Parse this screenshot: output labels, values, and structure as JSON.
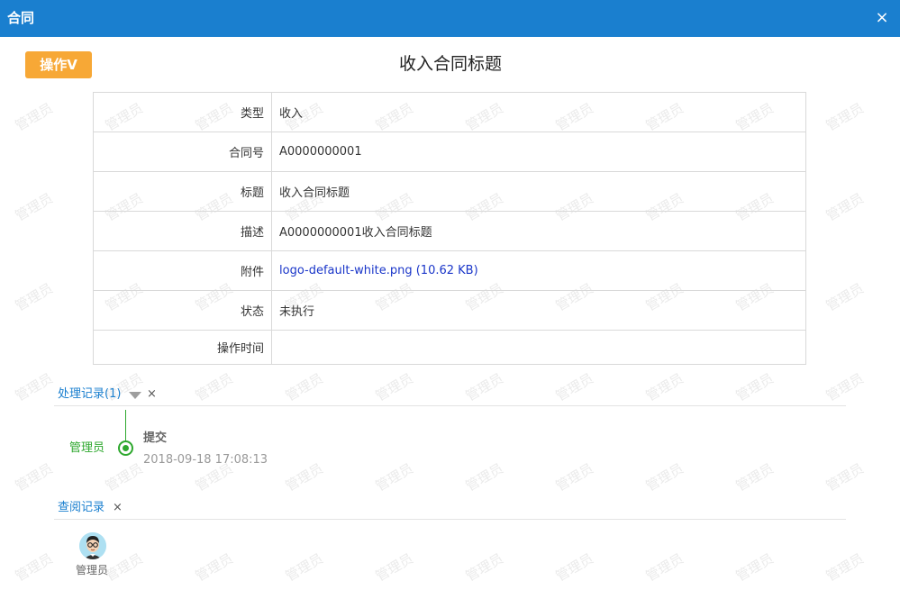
{
  "window": {
    "title": "合同",
    "close_label": "×"
  },
  "toolbar": {
    "operation_button": "操作V"
  },
  "document": {
    "title": "收入合同标题"
  },
  "fields": [
    {
      "label": "类型",
      "value": "收入"
    },
    {
      "label": "合同号",
      "value": "A0000000001"
    },
    {
      "label": "标题",
      "value": "收入合同标题"
    },
    {
      "label": "描述",
      "value": "A0000000001收入合同标题"
    },
    {
      "label": "附件",
      "value": "logo-default-white.png (10.62 KB)"
    },
    {
      "label": "状态",
      "value": "未执行"
    },
    {
      "label": "操作时间",
      "value": ""
    }
  ],
  "process_log": {
    "title": "处理记录(1)",
    "close_label": "×",
    "entries": [
      {
        "user": "管理员",
        "action": "提交",
        "time": "2018-09-18 17:08:13"
      }
    ]
  },
  "view_log": {
    "title": "查阅记录",
    "close_label": "×",
    "viewers": [
      {
        "name": "管理员",
        "icon": "user-avatar-icon"
      }
    ]
  },
  "watermark": {
    "text": "管理员"
  },
  "colors": {
    "titlebar": "#1a7fcf",
    "operation_button": "#f7a836",
    "link": "#1a36c9",
    "timeline": "#2ea82e"
  }
}
